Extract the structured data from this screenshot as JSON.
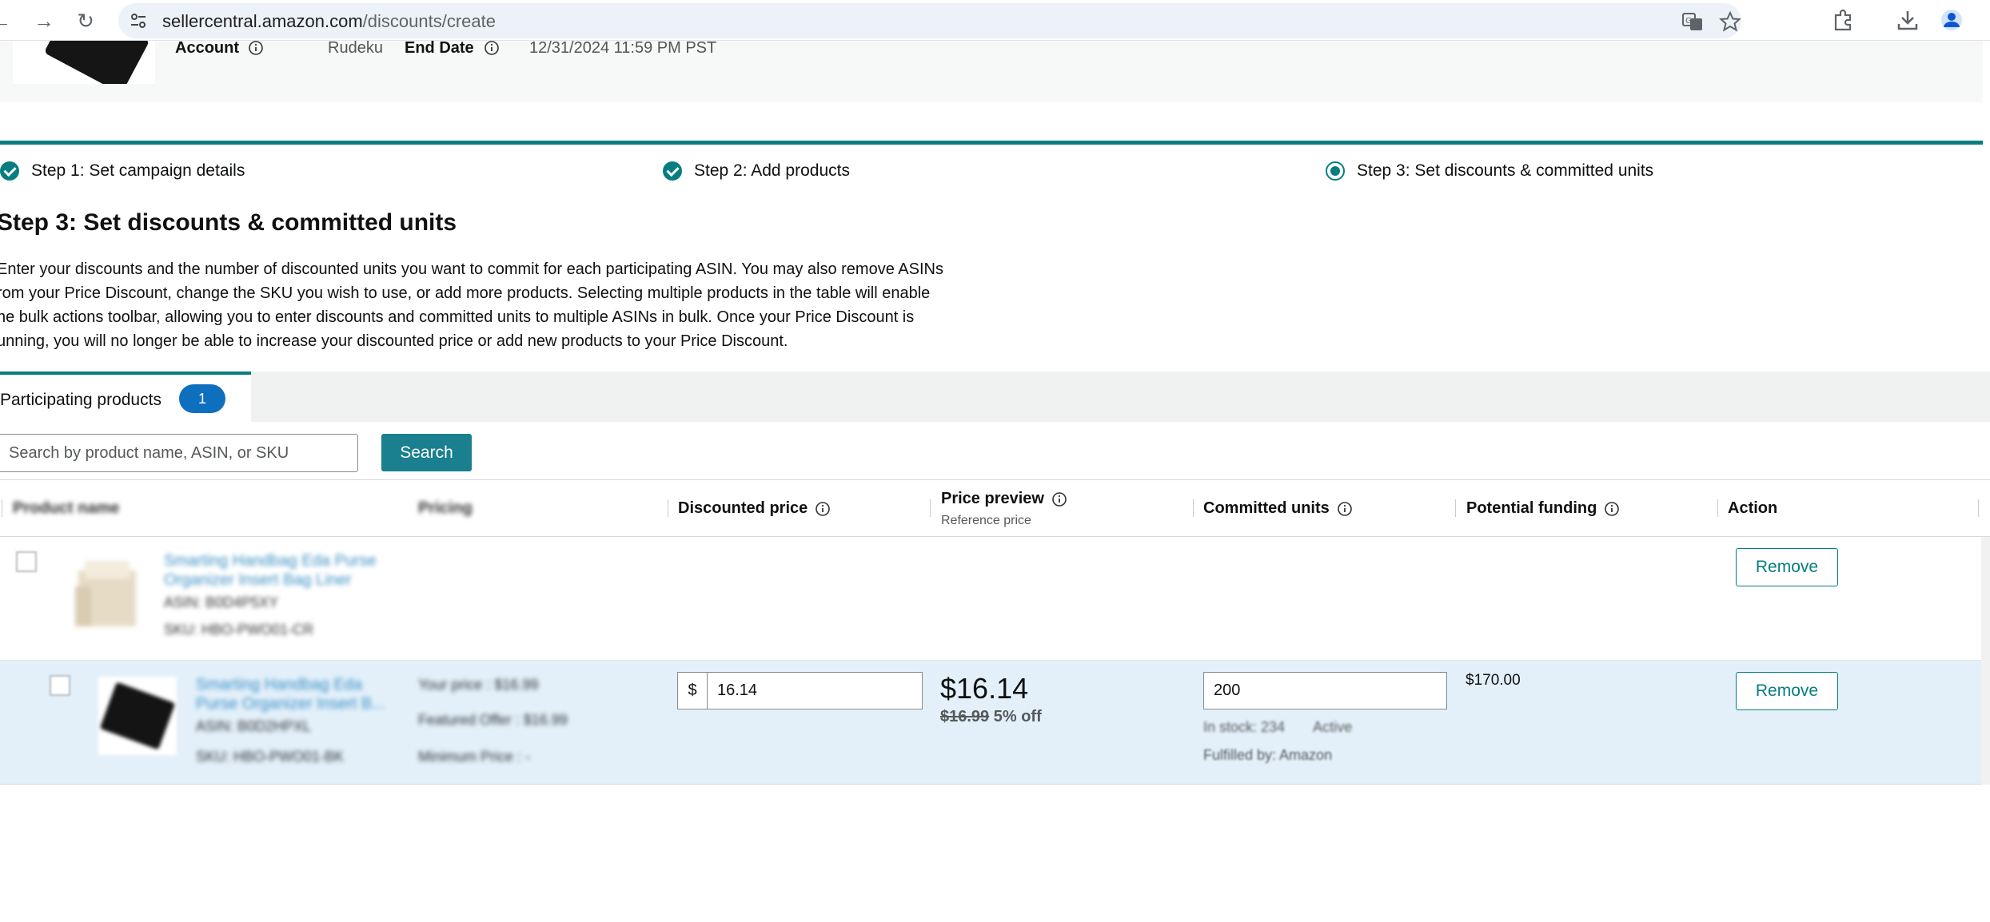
{
  "browser": {
    "url_host": "sellercentral.amazon.com",
    "url_path": "/discounts/create"
  },
  "campaign": {
    "account_label": "Account",
    "account_value": "Rudeku",
    "end_date_label": "End Date",
    "end_date_value": "12/31/2024 11:59 PM PST"
  },
  "steps": [
    {
      "label": "Step 1: Set campaign details",
      "state": "done"
    },
    {
      "label": "Step 2: Add products",
      "state": "done"
    },
    {
      "label": "Step 3: Set discounts & committed units",
      "state": "current"
    }
  ],
  "page": {
    "title": "Step 3: Set discounts & committed units",
    "description_lines": [
      "Enter your discounts and the number of discounted units you want to commit for each participating ASIN. You may also remove ASINs",
      "rom your Price Discount, change the SKU you wish to use, or add more products. Selecting multiple products in the table will enable",
      "he bulk actions toolbar, allowing you to enter discounts and committed units to multiple ASINs in bulk. Once your Price Discount is",
      "unning, you will no longer be able to increase your discounted price or add new products to your Price Discount."
    ]
  },
  "tabs": [
    {
      "label": "Participating products",
      "badge": "1"
    }
  ],
  "search": {
    "placeholder": "Search by product name, ASIN, or SKU",
    "button_label": "Search"
  },
  "table": {
    "columns": {
      "product": "Product name",
      "pricing": "Pricing",
      "discounted_price": "Discounted price",
      "price_preview": "Price preview",
      "price_preview_sub": "Reference price",
      "committed_units": "Committed units",
      "potential_funding": "Potential funding",
      "action": "Action"
    },
    "rows": [
      {
        "title_line1": "Smarting Handbag Eda Purse",
        "title_line2": "Organizer Insert Bag Liner",
        "asin": "ASIN: B0D4P5XY",
        "sku": "SKU: HBO-PWO01-CR",
        "action_label": "Remove"
      },
      {
        "title_line1": "Smarting Handbag Eda",
        "title_line2": "Purse Organizer Insert B...",
        "asin": "ASIN: B0D2HPXL",
        "sku": "SKU: HBO-PWO01-BK",
        "your_price": "Your price : $16.99",
        "featured_offer": "Featured Offer : $16.99",
        "minimum_price": "Minimum Price : -",
        "currency": "$",
        "discounted_price": "16.14",
        "preview_price": "$16.14",
        "reference_price": "$16.99",
        "percent_off": "5% off",
        "committed_units": "200",
        "stock": "In stock: 234",
        "status": "Active",
        "fulfilled_by": "Fulfilled by: Amazon",
        "potential_funding": "$170.00",
        "action_label": "Remove"
      }
    ]
  }
}
